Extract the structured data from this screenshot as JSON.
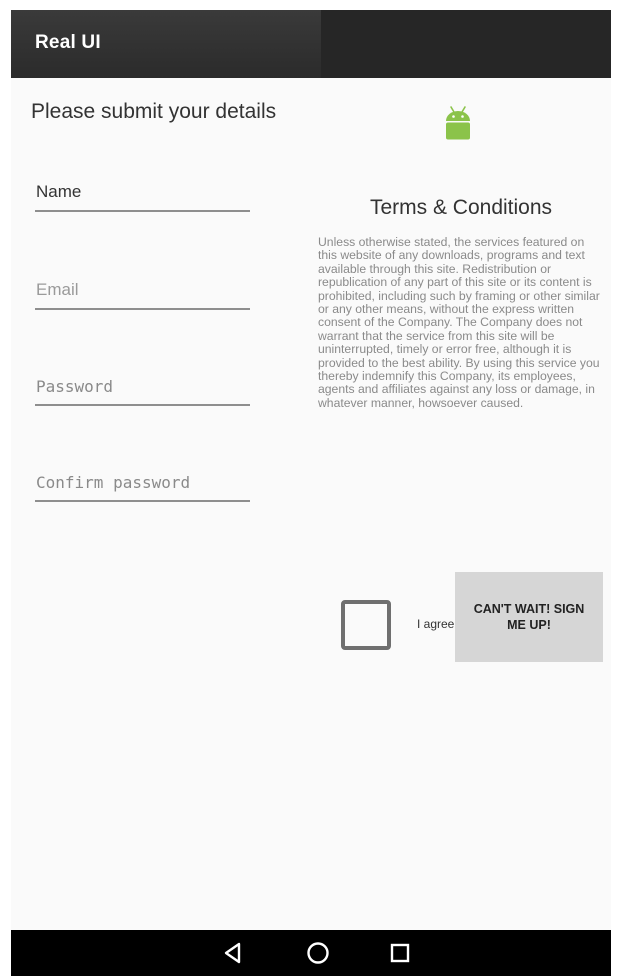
{
  "app_bar": {
    "title": "Real UI"
  },
  "form": {
    "heading": "Please submit your details",
    "fields": {
      "name": "Name",
      "email": "Email",
      "password": "Password",
      "confirm_password": "Confirm password"
    }
  },
  "terms": {
    "logo_icon": "android-icon",
    "title": "Terms & Conditions",
    "body": "Unless otherwise stated, the services featured on this website  of any downloads, programs and text available through this site. Redistribution or republication of any part of this site or its content is prohibited, including such by framing or other similar or any other means, without the express written consent of the Company. The Company does not warrant that the service from this site will be uninterrupted, timely or error free, although it is provided to the best ability. By using this service you thereby indemnify this Company, its employees, agents and affiliates against any loss or damage, in whatever manner, howsoever caused."
  },
  "agree": {
    "checked": false,
    "label": "I agree"
  },
  "signup_button": {
    "label": "CAN'T WAIT! SIGN ME UP!"
  },
  "nav": {
    "back_icon": "back-triangle-icon",
    "home_icon": "home-circle-icon",
    "recents_icon": "recents-square-icon"
  },
  "colors": {
    "app_bar": "#2b2b2b",
    "android_green": "#8bc34a",
    "button_bg": "#d6d6d6"
  }
}
